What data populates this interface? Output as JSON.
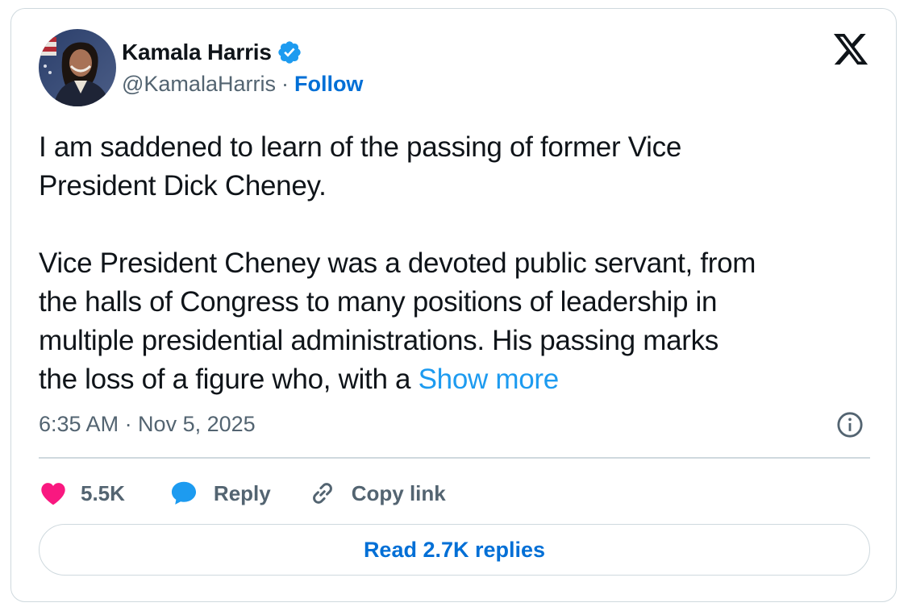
{
  "author": {
    "display_name": "Kamala Harris",
    "handle": "@KamalaHarris",
    "separator": "·",
    "follow_label": "Follow",
    "verified": true
  },
  "tweet": {
    "paragraph_1": "I am saddened to learn of the passing of former Vice\nPresident Dick Cheney.",
    "paragraph_2": "Vice President Cheney was a devoted public servant, from\nthe halls of Congress to many positions of leadership in\nmultiple presidential administrations. His passing marks\nthe loss of a figure who, with a ",
    "show_more_label": "Show more",
    "timestamp": "6:35 AM · Nov 5, 2025"
  },
  "actions": {
    "like_count": "5.5K",
    "reply_label": "Reply",
    "copy_link_label": "Copy link"
  },
  "read_replies_label": "Read 2.7K replies",
  "colors": {
    "text": "#0f1419",
    "secondary": "#536471",
    "link": "#1d9bf0",
    "follow": "#006fd6",
    "like": "#f91880",
    "border": "#cfd9de",
    "verified": "#1d9bf0"
  },
  "icons": {
    "brand": "x-logo-icon",
    "verified": "verified-badge-icon",
    "info": "info-icon",
    "like": "heart-icon",
    "reply": "speech-bubble-icon",
    "copy_link": "link-icon"
  }
}
